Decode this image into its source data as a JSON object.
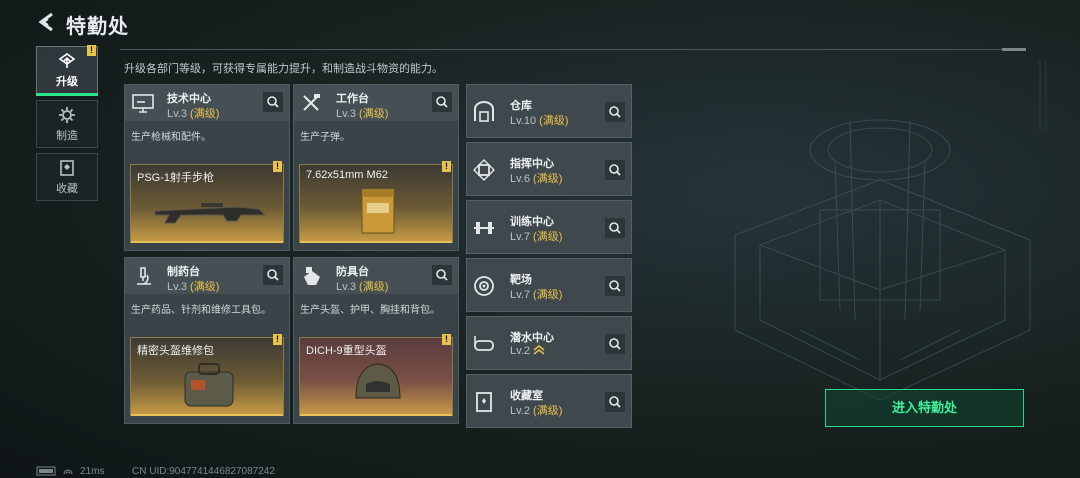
{
  "header": {
    "title": "特勤处",
    "subtitle": "升级各部门等级，可获得专属能力提升，和制造战斗物资的能力。"
  },
  "nav": [
    {
      "label": "升级",
      "icon": "upgrade-icon",
      "active": true,
      "alert": "!"
    },
    {
      "label": "制造",
      "icon": "gear-icon",
      "active": false
    },
    {
      "label": "收藏",
      "icon": "collection-icon",
      "active": false
    }
  ],
  "cards": [
    {
      "name": "技术中心",
      "level": "Lv.3",
      "status": "(满级)",
      "desc": "生产枪械和配件。",
      "product": "PSG-1射手步枪",
      "icon": "monitor-icon",
      "alert": "!"
    },
    {
      "name": "工作台",
      "level": "Lv.3",
      "status": "(满级)",
      "desc": "生产子弹。",
      "product": "7.62x51mm M62",
      "icon": "tools-icon",
      "alert": "!"
    },
    {
      "name": "制药台",
      "level": "Lv.3",
      "status": "(满级)",
      "desc": "生产药品、针剂和维修工具包。",
      "product": "精密头盔维修包",
      "icon": "microscope-icon",
      "alert": "!"
    },
    {
      "name": "防具台",
      "level": "Lv.3",
      "status": "(满级)",
      "desc": "生产头盔、护甲、胸挂和背包。",
      "product": "DICH-9重型头盔",
      "icon": "armor-icon",
      "alert": "!"
    }
  ],
  "small_cards": [
    {
      "name": "仓库",
      "level": "Lv.10",
      "status": "(满级)",
      "icon": "warehouse-icon"
    },
    {
      "name": "指挥中心",
      "level": "Lv.6",
      "status": "(满级)",
      "icon": "chip-icon"
    },
    {
      "name": "训练中心",
      "level": "Lv.7",
      "status": "(满级)",
      "icon": "dumbbell-icon"
    },
    {
      "name": "靶场",
      "level": "Lv.7",
      "status": "(满级)",
      "icon": "target-icon"
    },
    {
      "name": "潜水中心",
      "level": "Lv.2",
      "status": "",
      "icon": "diving-mask-icon",
      "upgrade_arrow": "upgrade-arrow-icon"
    },
    {
      "name": "收藏室",
      "level": "Lv.2",
      "status": "(满级)",
      "icon": "trophy-icon"
    }
  ],
  "enter_button": "进入特勤处",
  "footer": {
    "ping": "21ms",
    "uid": "CN UID:9047741446827087242"
  },
  "colors": {
    "accent_green": "#2fd587",
    "max_gold": "#e6c04a",
    "alert_yellow": "#e8c24a"
  }
}
